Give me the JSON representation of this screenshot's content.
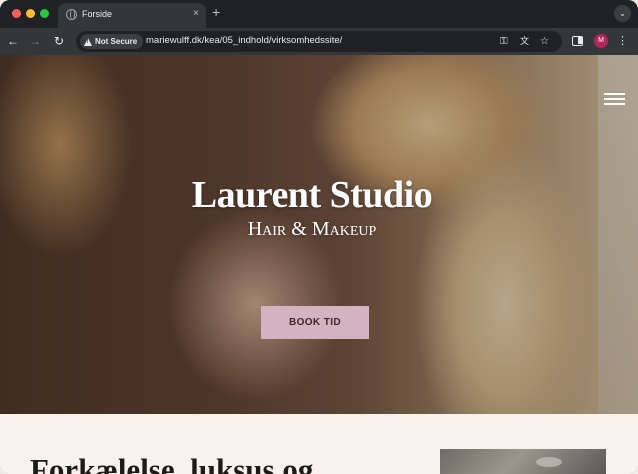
{
  "browser": {
    "tab": {
      "title": "Forside",
      "close_icon": "×"
    },
    "new_tab_icon": "+",
    "tab_menu_icon": "⌄",
    "nav": {
      "back": "←",
      "forward": "→",
      "reload": "↻"
    },
    "security_label": "Not Secure",
    "url": "mariewulff.dk/kea/05_indhold/virksomhedssite/",
    "icons": {
      "key": "⚿",
      "translate": "文",
      "star": "☆",
      "kebab": "⋮"
    },
    "profile_initial": "M"
  },
  "page": {
    "hero": {
      "title": "Laurent Studio",
      "subtitle": "Hair & Makeup",
      "cta_label": "BOOK TID"
    },
    "section": {
      "heading": "Forkælelse, luksus og"
    }
  },
  "colors": {
    "cta_background": "#d3b3bf",
    "page_background": "#f7f3ec",
    "profile_avatar": "#b3265a"
  }
}
